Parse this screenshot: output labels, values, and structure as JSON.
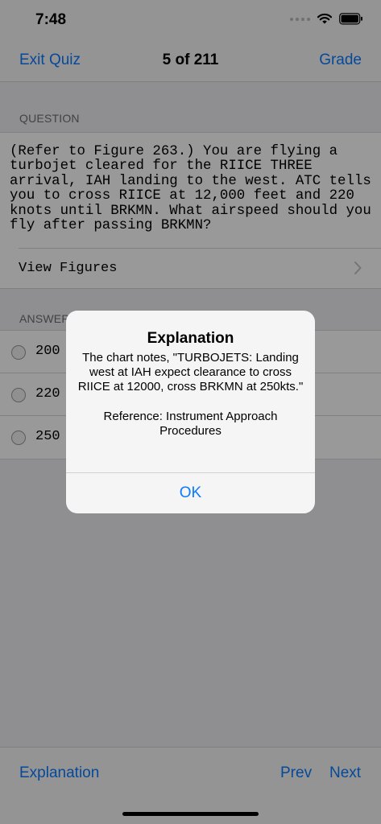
{
  "status_bar": {
    "time": "7:48"
  },
  "nav": {
    "left_button": "Exit Quiz",
    "title": "5 of 211",
    "right_button": "Grade"
  },
  "question": {
    "header": "QUESTION",
    "text": "(Refer to Figure 263.) You are flying a turbojet cleared for the RIICE THREE arrival, IAH landing to the west. ATC tells you to cross RIICE at 12,000 feet and 220 knots until BRKMN. What airspeed should you fly after passing BRKMN?",
    "view_figures_label": "View Figures"
  },
  "answers": {
    "header": "ANSWERS",
    "options": [
      {
        "label": "200"
      },
      {
        "label": "220"
      },
      {
        "label": "250"
      }
    ]
  },
  "toolbar": {
    "explanation_label": "Explanation",
    "prev_label": "Prev",
    "next_label": "Next"
  },
  "alert": {
    "title": "Explanation",
    "message": "The chart notes, \"TURBOJETS: Landing west at IAH expect clearance to cross RIICE at 12000, cross BRKMN at 250kts.\"\n\nReference: Instrument Approach Procedures",
    "ok_label": "OK"
  },
  "colors": {
    "accent": "#0a7aff",
    "background": "#efeff4",
    "overlay": "rgba(0,0,0,0.4)"
  }
}
